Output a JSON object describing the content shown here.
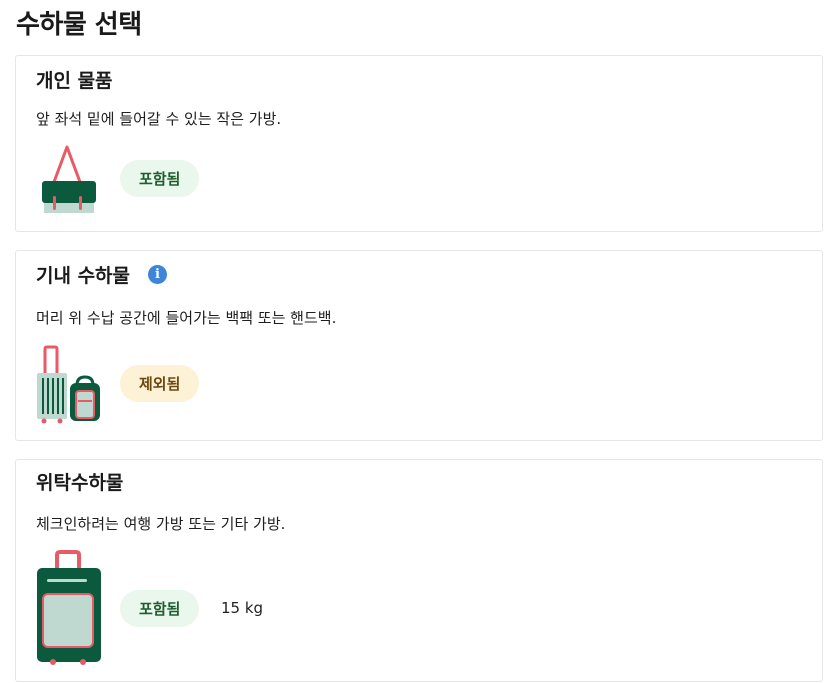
{
  "page": {
    "title": "수하물 선택"
  },
  "personal_item": {
    "title": "개인 물품",
    "description": "앞 좌석 밑에 들어갈 수 있는 작은 가방.",
    "status": "포함됨",
    "icon": "tote-bag-icon"
  },
  "carry_on": {
    "title": "기내 수하물",
    "info_icon": "i",
    "description": "머리 위 수납 공간에 들어가는 백팩 또는 핸드백.",
    "status": "제외됨",
    "icon": "suitcase-backpack-icon"
  },
  "checked_bag": {
    "title": "위탁수하물",
    "description": "체크인하려는 여행 가방 또는 기타 가방.",
    "status": "포함됨",
    "weight": "15 kg",
    "icon": "large-suitcase-icon"
  },
  "colors": {
    "bag_green": "#0b5a3d",
    "bag_light": "#c0d9d0",
    "bag_red": "#e85a66",
    "included_bg": "#e9f7ec",
    "excluded_bg": "#fdf1d6",
    "info_blue": "#3d85d8"
  }
}
